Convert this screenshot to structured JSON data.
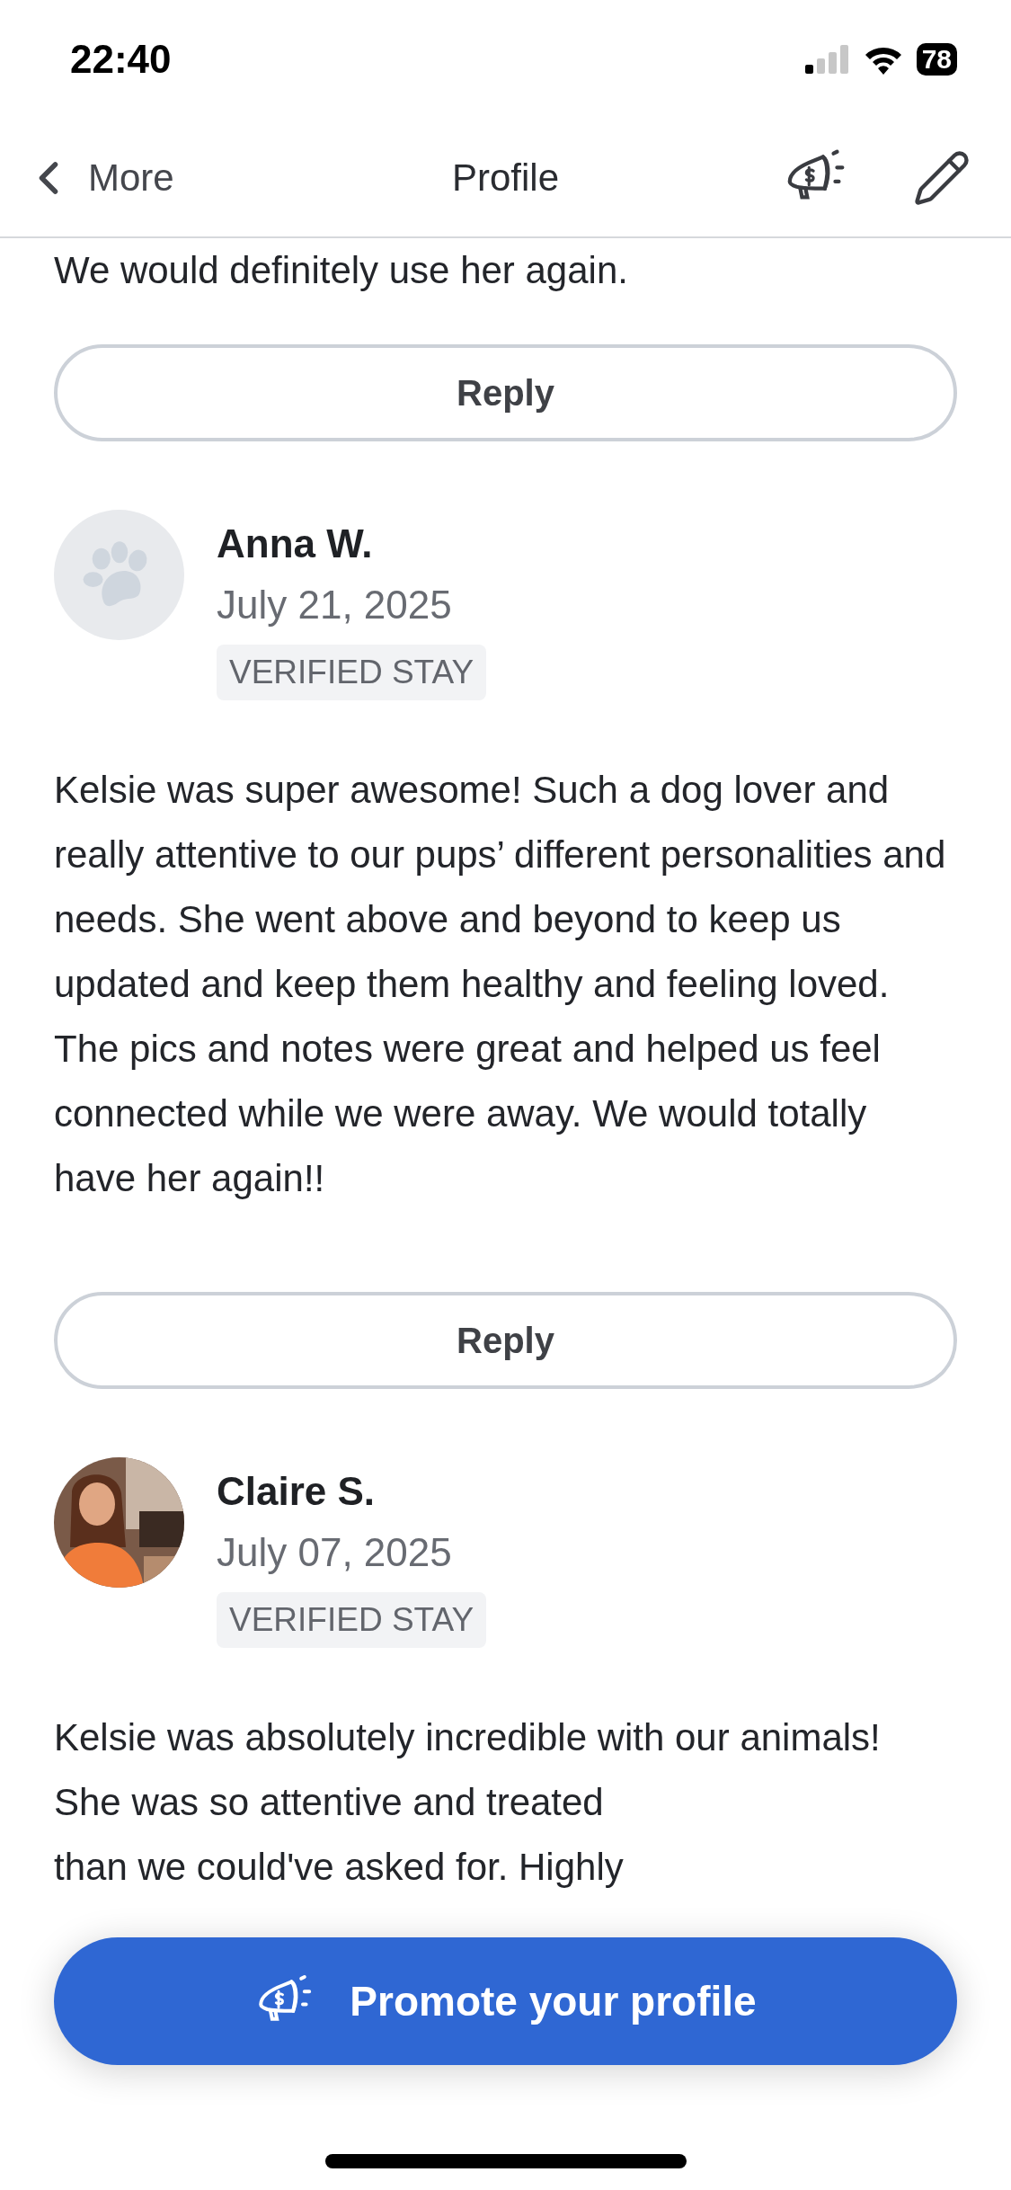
{
  "status_bar": {
    "time": "22:40",
    "battery": "78"
  },
  "nav": {
    "back_label": "More",
    "title": "Profile"
  },
  "partial_review": {
    "body": "We would definitely use her again.",
    "reply_label": "Reply"
  },
  "reviews": [
    {
      "avatar": {
        "kind": "paw"
      },
      "name": "Anna W.",
      "date": "July 21, 2025",
      "badge": "VERIFIED STAY",
      "body": "Kelsie was super awesome! Such a dog lover and really attentive to our pups’ different personalities and needs. She went above and beyond to keep us updated and keep them healthy and feeling loved. The pics and notes were great and helped us feel connected while we were away. We would totally have her again!!",
      "reply_label": "Reply"
    },
    {
      "name": "Claire S.",
      "date": "July 07, 2025",
      "badge": "VERIFIED STAY",
      "body": "Kelsie was absolutely incredible with our animals! She was so attentive and treated",
      "continuation": "than we could've asked for. Highly"
    }
  ],
  "promote_button": {
    "label": "Promote your profile"
  }
}
